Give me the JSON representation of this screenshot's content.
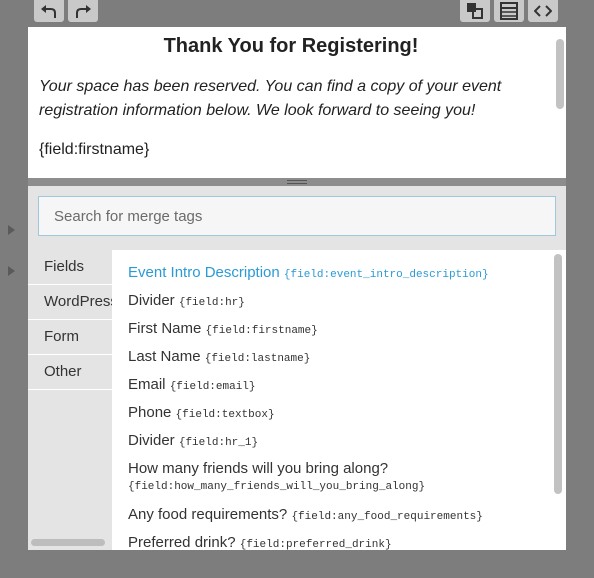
{
  "toolbar": {
    "undo_icon": "undo-icon",
    "redo_icon": "redo-icon",
    "merge_icon": "merge-tags-icon",
    "fields_icon": "list-icon",
    "code_icon": "code-icon"
  },
  "editor": {
    "title": "Thank You for Registering!",
    "intro": "Your space has been reserved. You can find a copy of your event registration information below. We look forward to seeing you!",
    "field": "{field:firstname}"
  },
  "merge": {
    "search_placeholder": "Search for merge tags",
    "categories": [
      "Fields",
      "WordPress",
      "Form",
      "Other"
    ],
    "items": [
      {
        "label": "Event Intro Description",
        "tag": "{field:event_intro_description}"
      },
      {
        "label": "Divider",
        "tag": "{field:hr}"
      },
      {
        "label": "First Name",
        "tag": "{field:firstname}"
      },
      {
        "label": "Last Name",
        "tag": "{field:lastname}"
      },
      {
        "label": "Email",
        "tag": "{field:email}"
      },
      {
        "label": "Phone",
        "tag": "{field:textbox}"
      },
      {
        "label": "Divider",
        "tag": "{field:hr_1}"
      },
      {
        "label": "How many friends will you bring along?",
        "tag": "{field:how_many_friends_will_you_bring_along}"
      },
      {
        "label": "Any food requirements?",
        "tag": "{field:any_food_requirements}"
      },
      {
        "label": "Preferred drink?",
        "tag": "{field:preferred_drink}"
      }
    ]
  },
  "colors": {
    "accent": "#2a9bd4",
    "background": "#7d7d7d"
  }
}
